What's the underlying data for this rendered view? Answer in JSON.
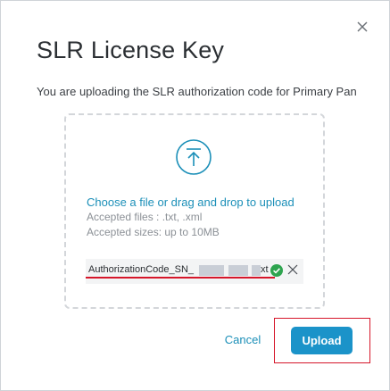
{
  "dialog": {
    "title": "SLR License Key",
    "subtitle": "You are uploading the SLR authorization code for Primary Pan"
  },
  "dropzone": {
    "prompt": "Choose a file or drag and drop to upload",
    "accepted_files": "Accepted files : .txt, .xml",
    "accepted_sizes": "Accepted sizes: up to 10MB",
    "icon": "upload-icon"
  },
  "file": {
    "name_prefix": "AuthorizationCode_SN_",
    "name_suffix": "xt",
    "status_icon": "check-circle-icon",
    "remove_icon": "close-icon"
  },
  "actions": {
    "cancel_label": "Cancel",
    "upload_label": "Upload"
  },
  "colors": {
    "accent": "#1b8fb8",
    "primary_button": "#1b93c9",
    "success": "#2ea44f",
    "annotation_red": "#d6162a"
  }
}
